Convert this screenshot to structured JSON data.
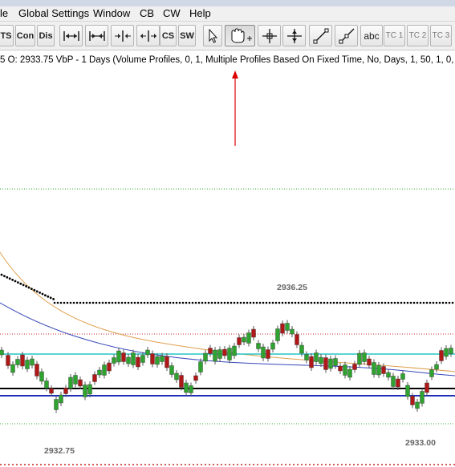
{
  "menu": [
    "le",
    "Global Settings",
    "Window",
    "CB",
    "CW",
    "Help"
  ],
  "toolbar": {
    "text_buttons": [
      "DTS",
      "Con",
      "Dis"
    ],
    "cs_label": "CS",
    "sw_label": "SW",
    "abc_label": "abc",
    "tc_buttons": [
      "TC 1",
      "TC 2",
      "TC 3"
    ],
    "icons": [
      "bar-spacing-decrease-icon",
      "bar-spacing-increase-icon",
      "scale-compress-icon",
      "scale-expand-icon",
      "pointer-icon",
      "hand-pan-icon",
      "crosshair-icon",
      "cursor-line-icon",
      "line-tool-icon",
      "ray-tool-icon"
    ]
  },
  "chart_info": {
    "text": "5 O: 2933.75 VbP - 1 Days   (Volume Profiles, 0, 1, Multiple Profiles Based On Fixed Time, No, Days, 1, 50, 1, 0,"
  },
  "chart_data": {
    "type": "candlestick",
    "labels": {
      "high": "2936.25",
      "low_left": "2932.75",
      "low_right": "2933.00"
    },
    "colors": {
      "up_candle": "#2fa32f",
      "down_candle": "#b01818",
      "cyan_line": "#26c6c6",
      "blue_line": "#1f2fb8",
      "navy_ma": "#3545b8",
      "orange_ma": "#e0a050",
      "arrow": "#dd0000",
      "dotted_green": "#33aa33",
      "dotted_red": "#cc2222"
    }
  }
}
